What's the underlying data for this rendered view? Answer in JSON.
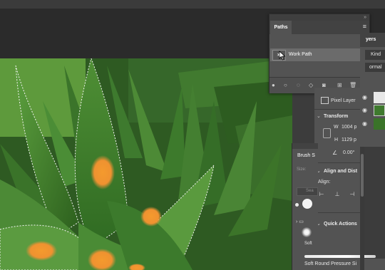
{
  "paths_panel": {
    "tab_label": "Paths",
    "menu_icon": "hamburger-menu-icon",
    "close_icon": "double-chevron-icon",
    "items": [
      {
        "name": "Work Path",
        "icon": "path-star-icon"
      }
    ],
    "footer_icons": [
      "fill-path-icon",
      "stroke-path-icon",
      "load-as-selection-icon",
      "make-work-path-icon",
      "add-mask-icon",
      "new-path-icon",
      "delete-path-icon"
    ]
  },
  "layers_panel": {
    "tab_label": "yers",
    "kind_label": "Kind",
    "blend_mode": "ormal"
  },
  "properties_panel": {
    "pixel_layer_label": "Pixel Layer",
    "transform_title": "Transform",
    "width_label": "W",
    "width_value": "1004 p",
    "height_label": "H",
    "height_value": "1129 p",
    "angle_value": "0.00°",
    "align_title": "Align and Dist",
    "align_label": "Align:",
    "quick_actions_title": "Quick Actions"
  },
  "brush_panel": {
    "tab_label": "Brush S",
    "size_label": "Size:",
    "search_placeholder": "Sea",
    "preset_label": "Soft",
    "bottom_preset_label": "Soft Round Pressure Si"
  },
  "colors": {
    "panel_bg": "#535353",
    "dark_bg": "#2b2b2b",
    "selected_row": "#6b6b6b",
    "highlight_orange": "#f0952c"
  }
}
